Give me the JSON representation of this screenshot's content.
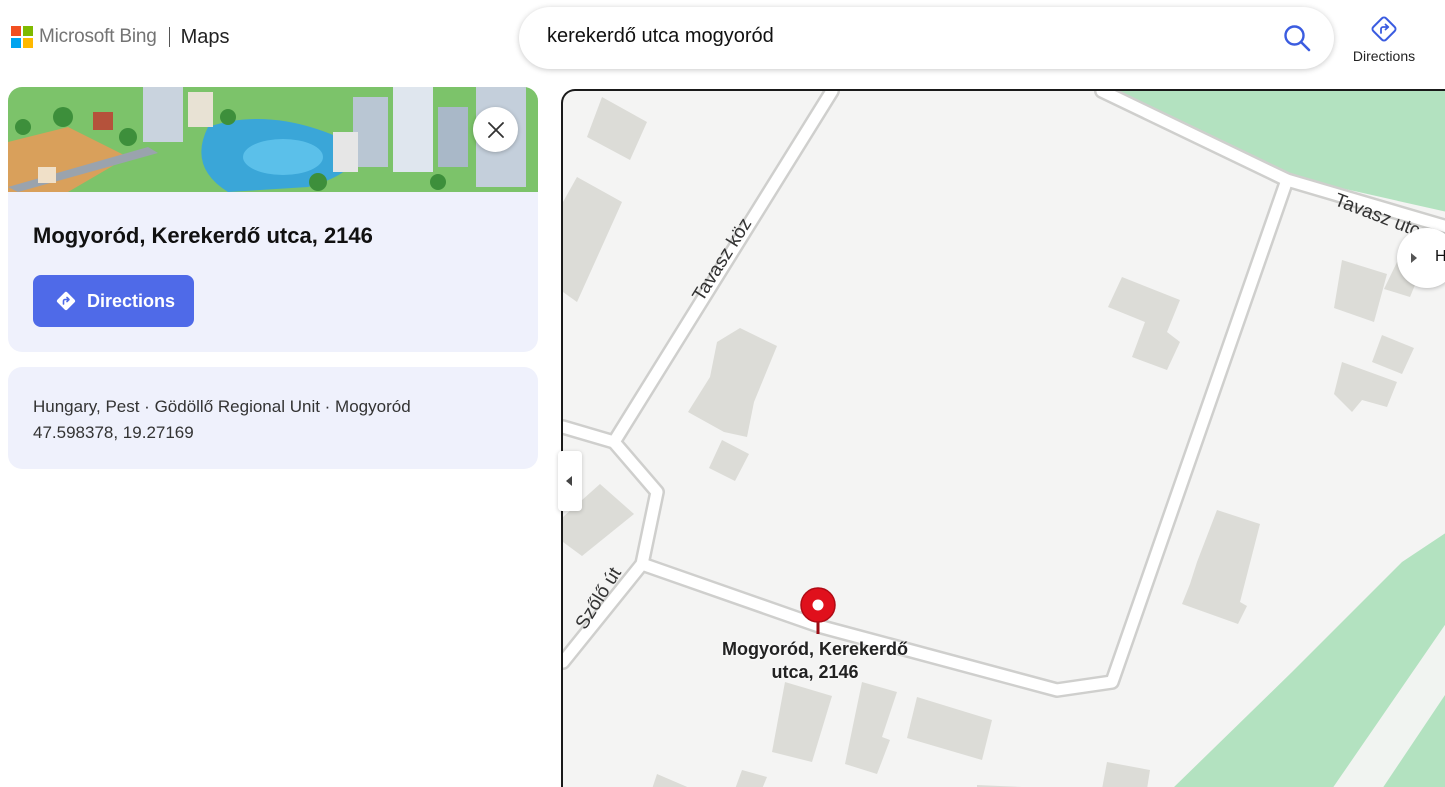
{
  "header": {
    "brand": "Microsoft Bing",
    "product": "Maps",
    "logo_colors": [
      "#f25022",
      "#7fba00",
      "#00a4ef",
      "#ffb900"
    ],
    "search": {
      "value": "kerekerdő utca mogyoród",
      "icon": "search-icon"
    },
    "directions_label": "Directions"
  },
  "place": {
    "title": "Mogyoród, Kerekerdő utca, 2146",
    "directions_label": "Directions",
    "address_line": "Hungary, Pest · Gödöllő Regional Unit · Mogyoród",
    "coordinates": "47.598378, 19.27169"
  },
  "map": {
    "roads": {
      "tavasz_koz": "Tavasz köz",
      "tavasz_utca": "Tavasz utca",
      "szolo_ut": "Szőlő út"
    },
    "pin_label_line1": "Mogyoród, Kerekerdő",
    "pin_label_line2": "utca, 2146",
    "side_tab_label": "H",
    "colors": {
      "land": "#f4f4f3",
      "park": "#b3e2c0",
      "building": "#dcdcd7",
      "pin": "#e0101c",
      "accent": "#4f6ae8"
    }
  }
}
